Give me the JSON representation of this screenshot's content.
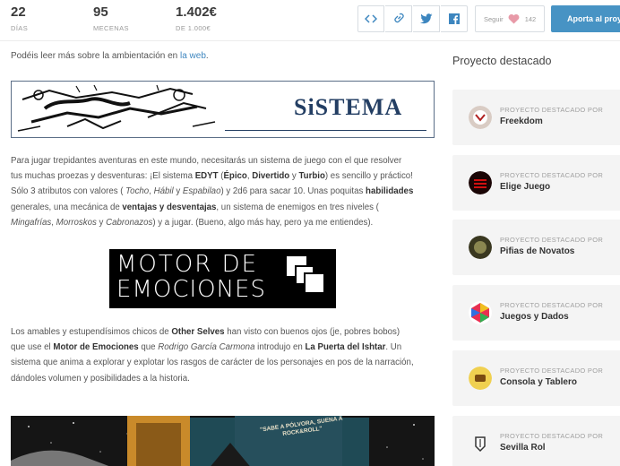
{
  "stats": [
    {
      "value": "22",
      "label": "DÍAS"
    },
    {
      "value": "95",
      "label": "MECENAS"
    },
    {
      "value": "1.402€",
      "label": "DE 1.000€"
    }
  ],
  "share_icons": [
    "embed-code-icon",
    "link-icon",
    "twitter-icon",
    "facebook-icon"
  ],
  "follow": {
    "label": "Seguir",
    "count": "142",
    "icon": "heart-icon"
  },
  "cta": {
    "label": "Aporta al proy"
  },
  "main": {
    "intro_text": "Podéis leer más sobre la ambientación en ",
    "intro_link": "la web",
    "intro_end": ".",
    "banner_title": "SiSTEMA",
    "para1": [
      "Para jugar trepidantes aventuras en este mundo, necesitarás un sistema de juego con el que resolver",
      "tus muchas proezas y desventuras: ¡El sistema ",
      "EDYT",
      " (",
      "Épico",
      ", ",
      "Divertido",
      " y ",
      "Turbio",
      ") es sencillo y práctico!",
      "Sólo 3 atributos con valores ( ",
      "Tocho",
      ", ",
      "Hábil",
      " y ",
      "Espabilao",
      ") y 2d6 para sacar 10. Unas poquitas ",
      "habilidades",
      "generales, una mecánica de ",
      "ventajas y desventajas",
      ", un sistema de enemigos en tres niveles (",
      "Mingafrías",
      ", ",
      "Morroskos",
      " y ",
      "Cabronazos",
      ") y a jugar. (Bueno, algo más hay, pero ya me entiendes)."
    ],
    "motor_line1": "MOTOR DE",
    "motor_line2": "EMOCIONES",
    "para2": [
      "Los amables y estupendísimos chicos de ",
      "Other Selves",
      " han visto con buenos ojos (je, pobres bobos)",
      "que use el ",
      "Motor de Emociones",
      " que ",
      "Rodrigo García Carmona",
      " introdujo en ",
      "La Puerta del Ishtar",
      ". Un",
      "sistema que anima a explorar y explotar los rasgos de carácter de los personajes en pos de la narración,",
      "dándoles volumen y posibilidades a la historia."
    ],
    "photo_text": "\"SABE A PÓLVORA, SUENA A ROCK&ROLL\""
  },
  "sidebar": {
    "title": "Proyecto destacado",
    "caption": "PROYECTO DESTACADO POR",
    "items": [
      {
        "name": "Freekdom",
        "color": "#c9b8b0"
      },
      {
        "name": "Elige Juego",
        "color": "#b01010"
      },
      {
        "name": "Pifias de Novatos",
        "color": "#6b6a3a"
      },
      {
        "name": "Juegos y Dados",
        "color": "#e0405a"
      },
      {
        "name": "Consola y Tablero",
        "color": "#e8c040"
      },
      {
        "name": "Sevilla Rol",
        "color": "#dddddd"
      }
    ]
  },
  "colors": {
    "accent": "#4793c4",
    "link": "#3d86bf",
    "banner_text": "#233e63",
    "heart": "#e89aa8"
  }
}
